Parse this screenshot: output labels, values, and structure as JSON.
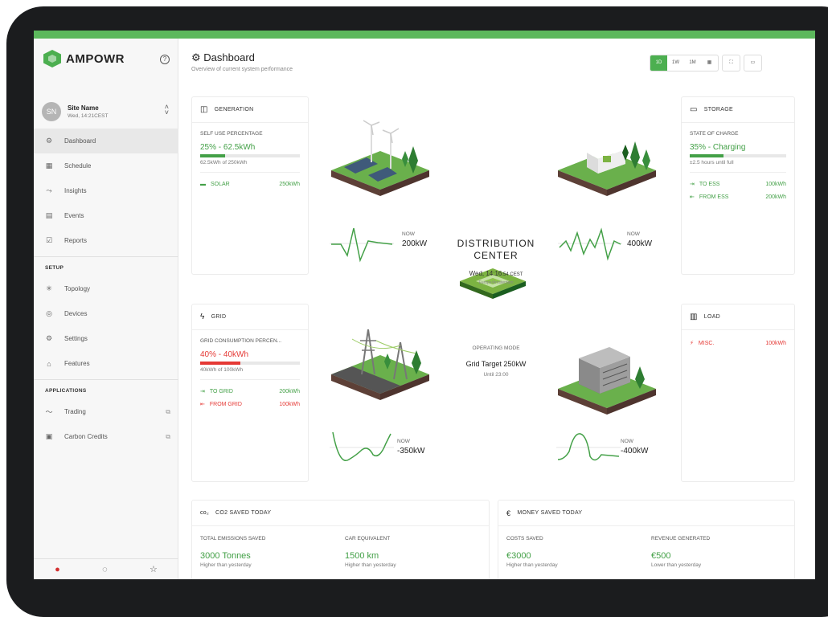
{
  "brand": "AMPOWR",
  "site": {
    "initials": "SN",
    "name": "Site Name",
    "date": "Wed, 14:21CEST"
  },
  "nav": {
    "items": [
      {
        "label": "Dashboard"
      },
      {
        "label": "Schedule"
      },
      {
        "label": "Insights"
      },
      {
        "label": "Events"
      },
      {
        "label": "Reports"
      }
    ],
    "setup_title": "SETUP",
    "setup": [
      {
        "label": "Topology"
      },
      {
        "label": "Devices"
      },
      {
        "label": "Settings"
      },
      {
        "label": "Features"
      }
    ],
    "apps_title": "APPLICATIONS",
    "apps": [
      {
        "label": "Trading"
      },
      {
        "label": "Carbon Credits"
      }
    ]
  },
  "header": {
    "title": "Dashboard",
    "subtitle": "Overview of current system performance"
  },
  "toolbar": {
    "ranges": [
      "1D",
      "1W",
      "1M"
    ]
  },
  "generation": {
    "title": "GENERATION",
    "metric_label": "SELF USE PERCENTAGE",
    "value": "25% - 62.5kWh",
    "sub": "62.5kWh of 250kWh",
    "fill": 0.25,
    "source_label": "SOLAR",
    "source_value": "250kWh",
    "now_label": "NOW",
    "now_value": "200kW"
  },
  "storage": {
    "title": "STORAGE",
    "metric_label": "STATE OF CHARGE",
    "value": "35% - Charging",
    "sub": "±2.5 hours until full",
    "fill": 0.35,
    "to_label": "TO ESS",
    "to_value": "100kWh",
    "from_label": "FROM ESS",
    "from_value": "200kWh",
    "now_label": "NOW",
    "now_value": "400kW"
  },
  "grid": {
    "title": "GRID",
    "metric_label": "GRID CONSUMPTION PERCEN...",
    "value": "40% - 40kWh",
    "sub": "40kWh of 100kWh",
    "fill": 0.4,
    "to_label": "TO GRID",
    "to_value": "200kWh",
    "from_label": "FROM GRID",
    "from_value": "100kWh",
    "now_label": "NOW",
    "now_value": "-350kW"
  },
  "load": {
    "title": "LOAD",
    "misc_label": "MISC.",
    "misc_value": "100kWh",
    "now_label": "NOW",
    "now_value": "-400kW"
  },
  "center": {
    "title_line1": "DISTRIBUTION",
    "title_line2": "CENTER",
    "time_main": "Wed, 14:16",
    "time_sec": ":54 CEST",
    "timezone": "Europe/Amsterdam",
    "op_label": "OPERATING MODE",
    "op_value": "Grid Target 250kW",
    "op_until": "Until 23:00"
  },
  "co2": {
    "title": "CO2 SAVED TODAY",
    "c1_label": "TOTAL EMISSIONS SAVED",
    "c1_value": "3000 Tonnes",
    "c1_sub": "Higher than yesterday",
    "c2_label": "CAR EQUIVALENT",
    "c2_value": "1500 km",
    "c2_sub": "Higher than yesterday"
  },
  "money": {
    "title": "MONEY SAVED TODAY",
    "c1_label": "COSTS SAVED",
    "c1_value": "€3000",
    "c1_sub": "Higher than yesterday",
    "c2_label": "REVENUE GENERATED",
    "c2_value": "€500",
    "c2_sub": "Lower than yesterday"
  },
  "colors": {
    "accent": "#4caf50",
    "positive": "#43a047",
    "negative": "#e53935"
  }
}
